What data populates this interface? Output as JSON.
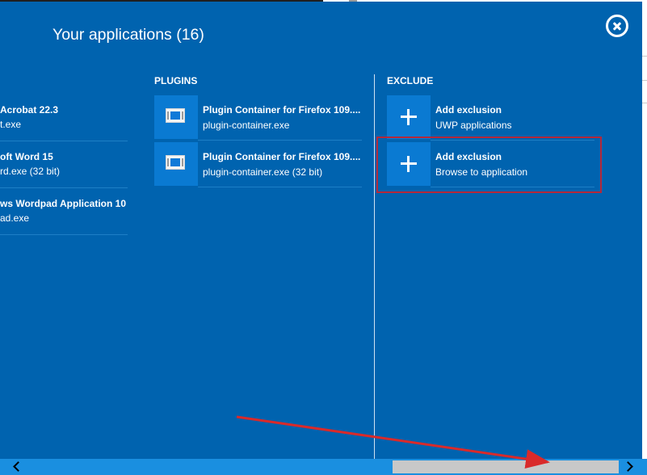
{
  "dialog": {
    "title": "Your applications (16)"
  },
  "columns": {
    "apps": {
      "items": [
        {
          "name": "Acrobat 22.3",
          "sub": "t.exe"
        },
        {
          "name": "oft Word 15",
          "sub": "rd.exe (32 bit)"
        },
        {
          "name": "ws Wordpad Application 10",
          "sub": "ad.exe"
        }
      ]
    },
    "plugins": {
      "header": "PLUGINS",
      "items": [
        {
          "name": "Plugin Container for Firefox 109....",
          "sub": "plugin-container.exe",
          "icon": "application-window-icon"
        },
        {
          "name": "Plugin Container for Firefox 109....",
          "sub": "plugin-container.exe (32 bit)",
          "icon": "application-window-icon"
        }
      ]
    },
    "exclude": {
      "header": "EXCLUDE",
      "items": [
        {
          "name": "Add exclusion",
          "sub": "UWP applications",
          "icon": "plus-icon"
        },
        {
          "name": "Add exclusion",
          "sub": "Browse to application",
          "icon": "plus-icon"
        }
      ]
    }
  },
  "colors": {
    "panel": "#0063AF",
    "tile": "#0A7AD2",
    "highlight": "#B5283A",
    "annotation_arrow": "#D92A2A",
    "scrollbar": "#1A8FE0"
  }
}
